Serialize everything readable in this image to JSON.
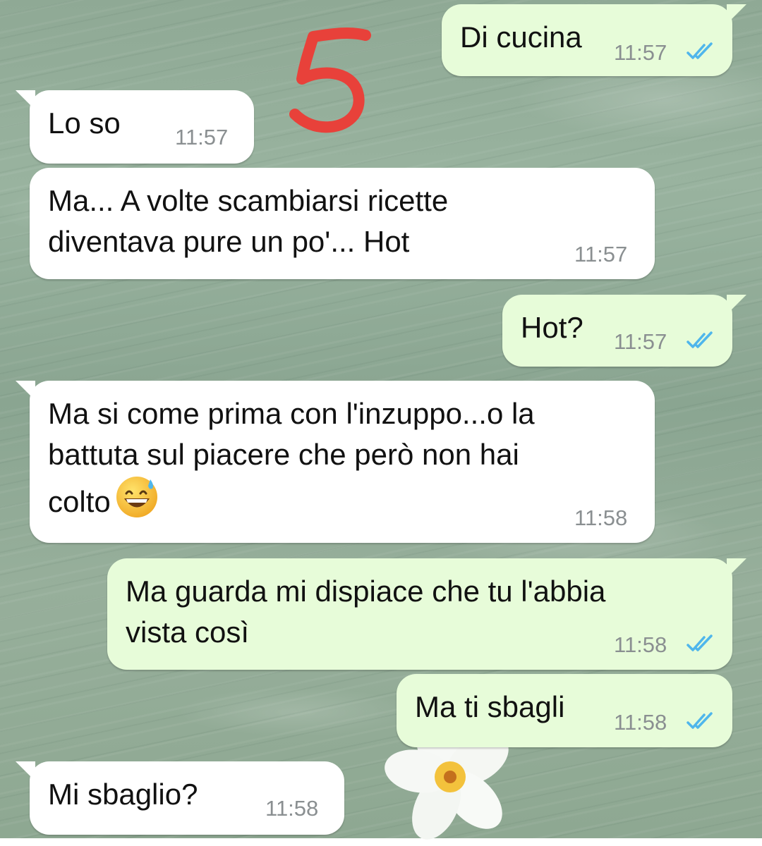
{
  "chat": {
    "messages": [
      {
        "direction": "out",
        "text": "Di cucina",
        "time": "11:57",
        "status": "read"
      },
      {
        "direction": "in",
        "text": "Lo so",
        "time": "11:57"
      },
      {
        "direction": "in",
        "text": "Ma... A volte scambiarsi ricette\ndiventava pure un po'... Hot",
        "time": "11:57"
      },
      {
        "direction": "out",
        "text": "Hot?",
        "time": "11:57",
        "status": "read"
      },
      {
        "direction": "in",
        "text": "Ma si come prima con l'inzuppo...o la\nbattuta sul piacere che però non hai\ncolto",
        "time": "11:58",
        "emoji": "grinning-face-with-sweat"
      },
      {
        "direction": "out",
        "text": "Ma guarda mi dispiace che tu l'abbia\nvista così",
        "time": "11:58",
        "status": "read"
      },
      {
        "direction": "out",
        "text": "Ma ti sbagli",
        "time": "11:58",
        "status": "read"
      },
      {
        "direction": "in",
        "text": "Mi sbaglio?",
        "time": "11:58"
      }
    ]
  },
  "annotation": {
    "text": "5",
    "color": "#e8413a"
  },
  "colors": {
    "incoming_bubble": "#ffffff",
    "outgoing_bubble": "#e7fcd9",
    "read_ticks": "#4fb6ec",
    "timestamp": "#8a8f91"
  },
  "icons": {
    "read_receipt": "double-check-icon",
    "wallpaper_flower": "plumeria-flower-icon"
  }
}
